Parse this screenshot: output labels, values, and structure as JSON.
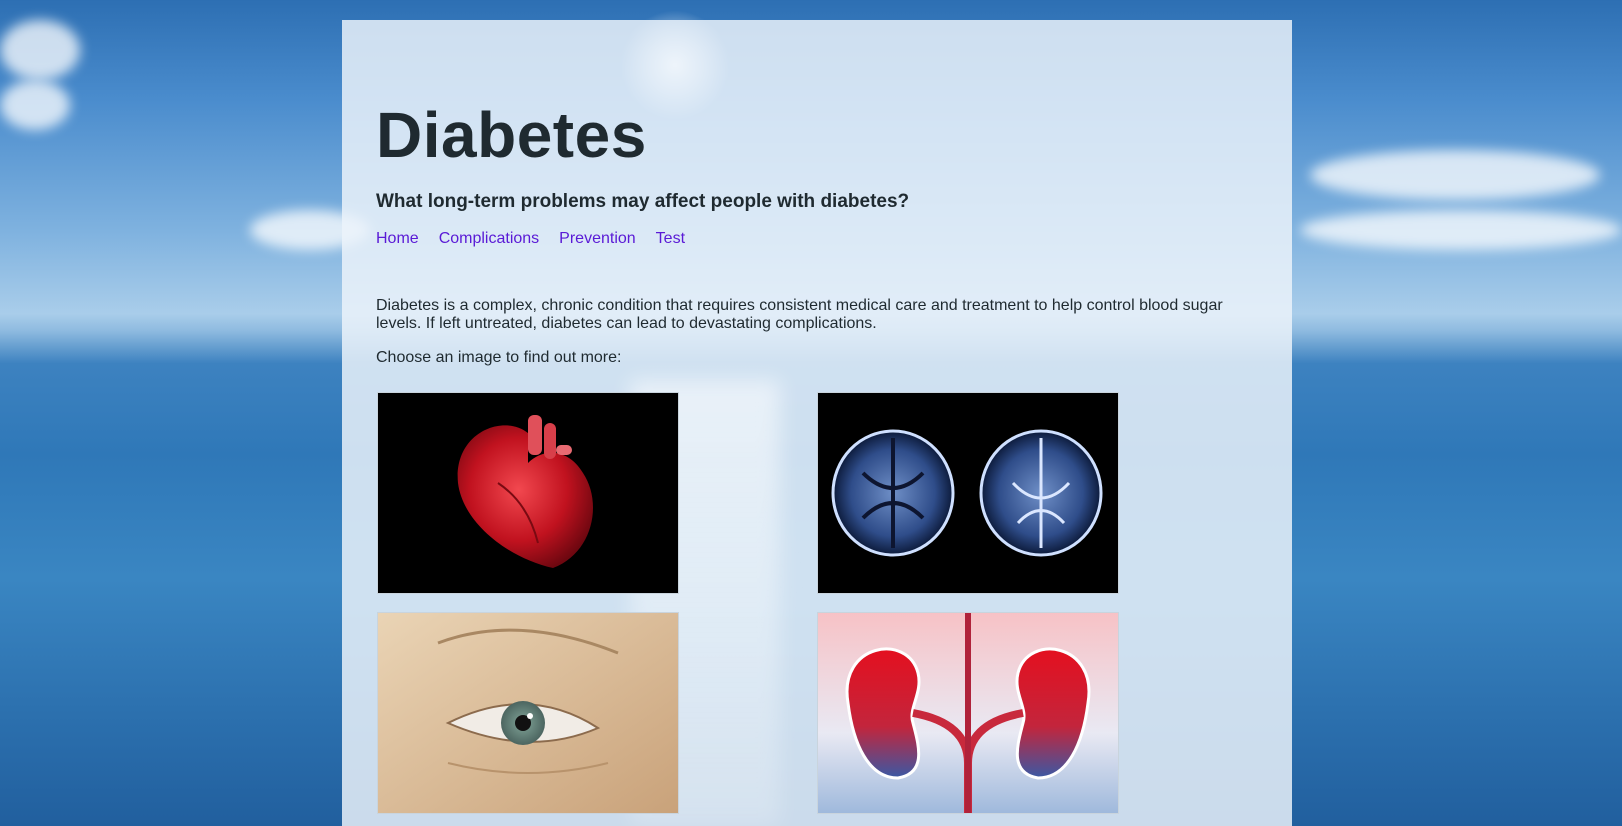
{
  "page": {
    "title": "Diabetes",
    "subtitle": "What long-term problems may affect people with diabetes?"
  },
  "nav": {
    "items": [
      {
        "label": "Home"
      },
      {
        "label": "Complications"
      },
      {
        "label": "Prevention"
      },
      {
        "label": "Test"
      }
    ]
  },
  "content": {
    "intro": "Diabetes is a complex, chronic condition that requires consistent medical care and treatment to help control blood sugar levels. If left untreated, diabetes can lead to devastating complications.",
    "prompt": "Choose an image to find out more:"
  },
  "gallery": {
    "images": [
      {
        "icon": "heart-icon"
      },
      {
        "icon": "brain-scan-icon"
      },
      {
        "icon": "eye-icon"
      },
      {
        "icon": "kidneys-icon"
      }
    ]
  }
}
